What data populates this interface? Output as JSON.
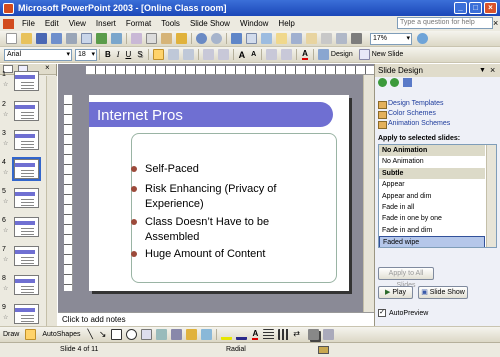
{
  "window": {
    "title": "Microsoft PowerPoint 2003 - [Online Class room]",
    "minimize": "_",
    "restore": "□",
    "close": "×"
  },
  "menu": {
    "items": [
      "File",
      "Edit",
      "View",
      "Insert",
      "Format",
      "Tools",
      "Slide Show",
      "Window",
      "Help"
    ],
    "help_placeholder": "Type a question for help",
    "close_doc": "×"
  },
  "toolbar": {
    "zoom": "17%"
  },
  "formatting": {
    "font": "Arial",
    "size": "18",
    "bold": "B",
    "italic": "I",
    "underline": "U",
    "shadow": "S",
    "grow": "A",
    "shrink": "A",
    "design_label": "Design",
    "new_slide_label": "New Slide"
  },
  "slides": {
    "numbers": [
      "1",
      "2",
      "3",
      "4",
      "5",
      "6",
      "7",
      "8",
      "9"
    ],
    "selected": 4
  },
  "slide": {
    "title": "Internet Pros",
    "bullets": [
      "Self-Paced",
      "Risk Enhancing (Privacy of Experience)",
      "Class Doesn’t Have to be Assembled",
      "Huge Amount of Content"
    ]
  },
  "notes_placeholder": "Click to add notes",
  "taskpane": {
    "title": "Slide Design",
    "close": "×",
    "links": [
      "Design Templates",
      "Color Schemes",
      "Animation Schemes"
    ],
    "section_label": "Apply to selected slides:",
    "animations": [
      {
        "label": "No Animation",
        "type": "header"
      },
      {
        "label": "No Animation",
        "type": "item"
      },
      {
        "label": "Subtle",
        "type": "header"
      },
      {
        "label": "Appear",
        "type": "item"
      },
      {
        "label": "Appear and dim",
        "type": "item"
      },
      {
        "label": "Fade in all",
        "type": "item"
      },
      {
        "label": "Fade in one by one",
        "type": "item"
      },
      {
        "label": "Fade in and dim",
        "type": "item"
      },
      {
        "label": "Faded wipe",
        "type": "selected"
      }
    ],
    "apply_all": "Apply to All Slides",
    "play": "Play",
    "slide_show": "Slide Show",
    "autopreview": "AutoPreview"
  },
  "drawbar": {
    "draw": "Draw",
    "autoshapes": "AutoShapes"
  },
  "status": {
    "slide": "Slide 4 of 11",
    "design": "Radial"
  },
  "colors": {
    "title_bar": "#2756c6",
    "slide_title_band": "#6f6fd2",
    "bullet": "#9c4a3a",
    "content_border": "#9ab4a4"
  }
}
